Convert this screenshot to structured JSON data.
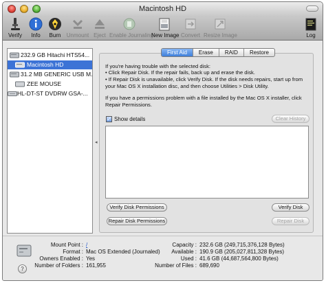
{
  "window": {
    "title": "Macintosh HD"
  },
  "toolbar": {
    "items": [
      {
        "label": "Verify",
        "icon": "microscope-icon",
        "enabled": true
      },
      {
        "label": "Info",
        "icon": "info-icon",
        "enabled": true
      },
      {
        "label": "Burn",
        "icon": "burn-icon",
        "enabled": true
      },
      {
        "label": "Unmount",
        "icon": "unmount-icon",
        "enabled": false
      },
      {
        "label": "Eject",
        "icon": "eject-icon",
        "enabled": false
      },
      {
        "label": "Enable Journaling",
        "icon": "journaling-icon",
        "enabled": false
      },
      {
        "label": "New Image",
        "icon": "new-image-icon",
        "enabled": true
      },
      {
        "label": "Convert",
        "icon": "convert-icon",
        "enabled": false
      },
      {
        "label": "Resize Image",
        "icon": "resize-image-icon",
        "enabled": false
      },
      {
        "label": "Log",
        "icon": "log-icon",
        "enabled": true
      }
    ]
  },
  "sidebar": {
    "items": [
      {
        "label": "232.9 GB Hitachi HTS54...",
        "kind": "disk",
        "selected": false
      },
      {
        "label": "Macintosh HD",
        "kind": "volume",
        "selected": true
      },
      {
        "label": "31.2 MB GENERIC USB M...",
        "kind": "disk",
        "selected": false
      },
      {
        "label": "ZEE MOUSE",
        "kind": "volume",
        "selected": false
      },
      {
        "label": "HL-DT-ST DVDRW GSA-...",
        "kind": "optical",
        "selected": false
      }
    ]
  },
  "tabs": [
    {
      "label": "First Aid",
      "active": true
    },
    {
      "label": "Erase",
      "active": false
    },
    {
      "label": "RAID",
      "active": false
    },
    {
      "label": "Restore",
      "active": false
    }
  ],
  "first_aid": {
    "intro": "If you're having trouble with the selected disk:",
    "bullet1": "• Click Repair Disk. If the repair fails, back up and erase the disk.",
    "bullet2": "• If Repair Disk is unavailable, click Verify Disk. If the disk needs repairs, start up from your Mac OS X installation disc, and then choose Utilities > Disk Utility.",
    "permissions_note": "If you have a permissions problem with a file installed by the Mac OS X installer, click Repair Permissions.",
    "show_details_label": "Show details",
    "show_details_checked": true,
    "clear_history_label": "Clear History",
    "verify_permissions_label": "Verify Disk Permissions",
    "repair_permissions_label": "Repair Disk Permissions",
    "verify_disk_label": "Verify Disk",
    "repair_disk_label": "Repair Disk"
  },
  "info": {
    "mount_point_label": "Mount Point :",
    "mount_point_value": "/",
    "format_label": "Format :",
    "format_value": "Mac OS Extended (Journaled)",
    "owners_label": "Owners Enabled :",
    "owners_value": "Yes",
    "folders_label": "Number of Folders :",
    "folders_value": "161,955",
    "capacity_label": "Capacity :",
    "capacity_value": "232.6 GB (249,715,376,128 Bytes)",
    "available_label": "Available :",
    "available_value": "190.9 GB (205,027,811,328 Bytes)",
    "used_label": "Used :",
    "used_value": "41.6 GB (44,687,564,800 Bytes)",
    "files_label": "Number of Files :",
    "files_value": "689,690"
  },
  "help": {
    "label": "?"
  }
}
